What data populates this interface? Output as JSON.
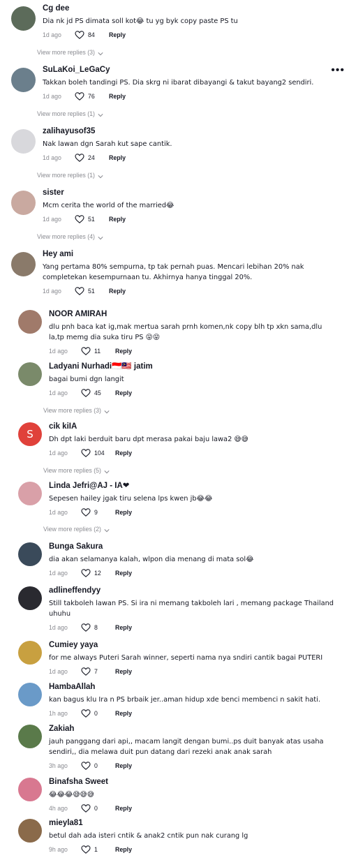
{
  "comments": [
    {
      "user": "Cg dee",
      "text": "Dia nk jd PS dimata soll kot😂 tu yg byk copy paste PS tu",
      "time": "1d ago",
      "likes": "84",
      "reply": "Reply",
      "view_more": "View more replies (3)",
      "avatar_color": "#5c6b5a"
    },
    {
      "user": "SuLaKoi_LeGaCy",
      "text": "Takkan boleh tandingi PS. Dia skrg ni ibarat dibayangi & takut bayang2 sendiri.",
      "time": "1d ago",
      "likes": "76",
      "reply": "Reply",
      "view_more": "View more replies (1)",
      "avatar_color": "#6b7f8c"
    },
    {
      "user": "zalihayusof35",
      "text": "Nak lawan dgn Sarah kut sape cantik.",
      "time": "1d ago",
      "likes": "24",
      "reply": "Reply",
      "view_more": "View more replies (1)",
      "avatar_color": "#d8d8dc"
    },
    {
      "user": "sister",
      "text": "Mcm cerita the world of the married😂",
      "time": "1d ago",
      "likes": "51",
      "reply": "Reply",
      "view_more": "View more replies (4)",
      "avatar_color": "#c9a9a0"
    },
    {
      "user": "Hey ami",
      "text": "Yang pertama 80% sempurna, tp tak pernah puas. Mencari lebihan 20% nak completekan kesempurnaan tu. Akhirnya hanya tinggal 20%.",
      "time": "1d ago",
      "likes": "51",
      "reply": "Reply",
      "avatar_color": "#8a7a6a"
    }
  ],
  "replies": [
    {
      "user": "NOOR AMIRAH",
      "text": "dlu pnh baca kat ig,mak mertua sarah prnh komen,nk copy blh tp xkn sama,dlu la,tp memg dia suka tiru PS 😝😝",
      "time": "1d ago",
      "likes": "11",
      "reply": "Reply",
      "avatar_color": "#a07a6a"
    },
    {
      "user": "Ladyani Nurhadi🇮🇩🇲🇾 jatim",
      "text": "bagai bumi dgn langit",
      "time": "1d ago",
      "likes": "45",
      "reply": "Reply",
      "view_more": "View more replies (3)",
      "avatar_color": "#7a8a6a"
    },
    {
      "user": "cik kiIA",
      "text": "Dh dpt laki berduit baru dpt merasa pakai baju lawa2 😅😅",
      "time": "1d ago",
      "likes": "104",
      "reply": "Reply",
      "view_more": "View more replies (5)",
      "avatar_letter": "S",
      "avatar_color": "#e0413a"
    },
    {
      "user": "Linda Jefri@AJ - IA❤",
      "text": "Sepesen hailey jgak tiru selena lps kwen jb😂😂",
      "time": "1d ago",
      "likes": "9",
      "reply": "Reply",
      "view_more": "View more replies (2)",
      "avatar_color": "#d9a0a8"
    },
    {
      "user": "Bunga Sakura",
      "text": "dia akan selamanya kalah, wlpon dia menang di mata sol😂",
      "time": "1d ago",
      "likes": "12",
      "reply": "Reply",
      "avatar_color": "#3a4a5a"
    },
    {
      "user": "adlineffendyy",
      "text": "Still takboleh lawan PS. Si ira ni memang takboleh lari , memang package Thailand uhuhu",
      "time": "1d ago",
      "likes": "8",
      "reply": "Reply",
      "avatar_color": "#2a2a30"
    },
    {
      "user": "Cumiey yaya",
      "text": "for me always Puteri Sarah winner, seperti nama nya sndiri cantik bagai PUTERI",
      "time": "1d ago",
      "likes": "7",
      "reply": "Reply",
      "avatar_color": "#c8a040"
    },
    {
      "user": "HambaAllah",
      "text": "kan bagus klu Ira n PS brbaik jer..aman hidup xde benci membenci n sakit hati.",
      "time": "1h ago",
      "likes": "0",
      "reply": "Reply",
      "avatar_color": "#6a9ac8"
    },
    {
      "user": "Zakiah",
      "text": "jauh panggang dari api,, macam langit dengan bumi..ps duit banyak atas usaha sendiri,, dia melawa duit pun datang dari rezeki anak anak sarah",
      "time": "3h ago",
      "likes": "0",
      "reply": "Reply",
      "avatar_color": "#5a7a4a"
    },
    {
      "user": "Binafsha Sweet",
      "text": "😂😂😂😅😅😅",
      "time": "4h ago",
      "likes": "0",
      "reply": "Reply",
      "avatar_color": "#d87890"
    },
    {
      "user": "mieyla81",
      "text": "betul dah ada isteri cntik & anak2 cntik pun nak curang lg",
      "time": "9h ago",
      "likes": "1",
      "reply": "Reply",
      "avatar_color": "#8a6a4a"
    }
  ],
  "icons": {
    "more": "more-horizontal-icon",
    "heart": "heart-outline-icon",
    "chevron": "chevron-down-icon"
  },
  "more_dots": "•••"
}
